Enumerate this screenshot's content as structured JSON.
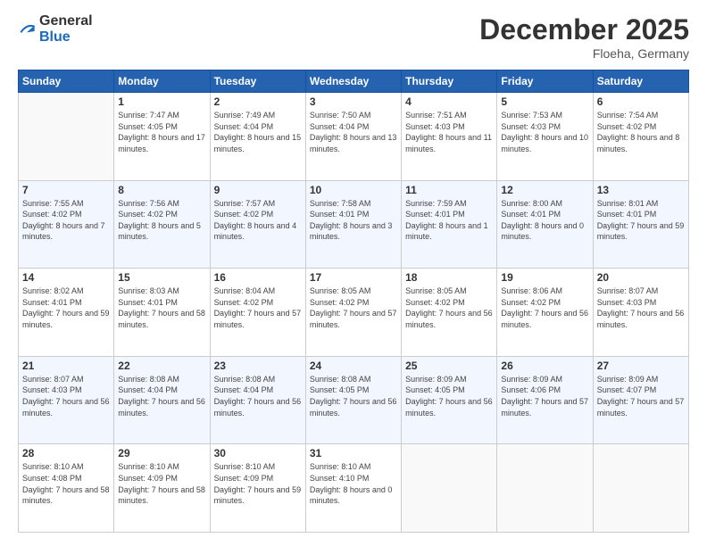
{
  "logo": {
    "general": "General",
    "blue": "Blue"
  },
  "header": {
    "month": "December 2025",
    "location": "Floeha, Germany"
  },
  "weekdays": [
    "Sunday",
    "Monday",
    "Tuesday",
    "Wednesday",
    "Thursday",
    "Friday",
    "Saturday"
  ],
  "weeks": [
    [
      {
        "day": "",
        "sunrise": "",
        "sunset": "",
        "daylight": ""
      },
      {
        "day": "1",
        "sunrise": "Sunrise: 7:47 AM",
        "sunset": "Sunset: 4:05 PM",
        "daylight": "Daylight: 8 hours and 17 minutes."
      },
      {
        "day": "2",
        "sunrise": "Sunrise: 7:49 AM",
        "sunset": "Sunset: 4:04 PM",
        "daylight": "Daylight: 8 hours and 15 minutes."
      },
      {
        "day": "3",
        "sunrise": "Sunrise: 7:50 AM",
        "sunset": "Sunset: 4:04 PM",
        "daylight": "Daylight: 8 hours and 13 minutes."
      },
      {
        "day": "4",
        "sunrise": "Sunrise: 7:51 AM",
        "sunset": "Sunset: 4:03 PM",
        "daylight": "Daylight: 8 hours and 11 minutes."
      },
      {
        "day": "5",
        "sunrise": "Sunrise: 7:53 AM",
        "sunset": "Sunset: 4:03 PM",
        "daylight": "Daylight: 8 hours and 10 minutes."
      },
      {
        "day": "6",
        "sunrise": "Sunrise: 7:54 AM",
        "sunset": "Sunset: 4:02 PM",
        "daylight": "Daylight: 8 hours and 8 minutes."
      }
    ],
    [
      {
        "day": "7",
        "sunrise": "Sunrise: 7:55 AM",
        "sunset": "Sunset: 4:02 PM",
        "daylight": "Daylight: 8 hours and 7 minutes."
      },
      {
        "day": "8",
        "sunrise": "Sunrise: 7:56 AM",
        "sunset": "Sunset: 4:02 PM",
        "daylight": "Daylight: 8 hours and 5 minutes."
      },
      {
        "day": "9",
        "sunrise": "Sunrise: 7:57 AM",
        "sunset": "Sunset: 4:02 PM",
        "daylight": "Daylight: 8 hours and 4 minutes."
      },
      {
        "day": "10",
        "sunrise": "Sunrise: 7:58 AM",
        "sunset": "Sunset: 4:01 PM",
        "daylight": "Daylight: 8 hours and 3 minutes."
      },
      {
        "day": "11",
        "sunrise": "Sunrise: 7:59 AM",
        "sunset": "Sunset: 4:01 PM",
        "daylight": "Daylight: 8 hours and 1 minute."
      },
      {
        "day": "12",
        "sunrise": "Sunrise: 8:00 AM",
        "sunset": "Sunset: 4:01 PM",
        "daylight": "Daylight: 8 hours and 0 minutes."
      },
      {
        "day": "13",
        "sunrise": "Sunrise: 8:01 AM",
        "sunset": "Sunset: 4:01 PM",
        "daylight": "Daylight: 7 hours and 59 minutes."
      }
    ],
    [
      {
        "day": "14",
        "sunrise": "Sunrise: 8:02 AM",
        "sunset": "Sunset: 4:01 PM",
        "daylight": "Daylight: 7 hours and 59 minutes."
      },
      {
        "day": "15",
        "sunrise": "Sunrise: 8:03 AM",
        "sunset": "Sunset: 4:01 PM",
        "daylight": "Daylight: 7 hours and 58 minutes."
      },
      {
        "day": "16",
        "sunrise": "Sunrise: 8:04 AM",
        "sunset": "Sunset: 4:02 PM",
        "daylight": "Daylight: 7 hours and 57 minutes."
      },
      {
        "day": "17",
        "sunrise": "Sunrise: 8:05 AM",
        "sunset": "Sunset: 4:02 PM",
        "daylight": "Daylight: 7 hours and 57 minutes."
      },
      {
        "day": "18",
        "sunrise": "Sunrise: 8:05 AM",
        "sunset": "Sunset: 4:02 PM",
        "daylight": "Daylight: 7 hours and 56 minutes."
      },
      {
        "day": "19",
        "sunrise": "Sunrise: 8:06 AM",
        "sunset": "Sunset: 4:02 PM",
        "daylight": "Daylight: 7 hours and 56 minutes."
      },
      {
        "day": "20",
        "sunrise": "Sunrise: 8:07 AM",
        "sunset": "Sunset: 4:03 PM",
        "daylight": "Daylight: 7 hours and 56 minutes."
      }
    ],
    [
      {
        "day": "21",
        "sunrise": "Sunrise: 8:07 AM",
        "sunset": "Sunset: 4:03 PM",
        "daylight": "Daylight: 7 hours and 56 minutes."
      },
      {
        "day": "22",
        "sunrise": "Sunrise: 8:08 AM",
        "sunset": "Sunset: 4:04 PM",
        "daylight": "Daylight: 7 hours and 56 minutes."
      },
      {
        "day": "23",
        "sunrise": "Sunrise: 8:08 AM",
        "sunset": "Sunset: 4:04 PM",
        "daylight": "Daylight: 7 hours and 56 minutes."
      },
      {
        "day": "24",
        "sunrise": "Sunrise: 8:08 AM",
        "sunset": "Sunset: 4:05 PM",
        "daylight": "Daylight: 7 hours and 56 minutes."
      },
      {
        "day": "25",
        "sunrise": "Sunrise: 8:09 AM",
        "sunset": "Sunset: 4:05 PM",
        "daylight": "Daylight: 7 hours and 56 minutes."
      },
      {
        "day": "26",
        "sunrise": "Sunrise: 8:09 AM",
        "sunset": "Sunset: 4:06 PM",
        "daylight": "Daylight: 7 hours and 57 minutes."
      },
      {
        "day": "27",
        "sunrise": "Sunrise: 8:09 AM",
        "sunset": "Sunset: 4:07 PM",
        "daylight": "Daylight: 7 hours and 57 minutes."
      }
    ],
    [
      {
        "day": "28",
        "sunrise": "Sunrise: 8:10 AM",
        "sunset": "Sunset: 4:08 PM",
        "daylight": "Daylight: 7 hours and 58 minutes."
      },
      {
        "day": "29",
        "sunrise": "Sunrise: 8:10 AM",
        "sunset": "Sunset: 4:09 PM",
        "daylight": "Daylight: 7 hours and 58 minutes."
      },
      {
        "day": "30",
        "sunrise": "Sunrise: 8:10 AM",
        "sunset": "Sunset: 4:09 PM",
        "daylight": "Daylight: 7 hours and 59 minutes."
      },
      {
        "day": "31",
        "sunrise": "Sunrise: 8:10 AM",
        "sunset": "Sunset: 4:10 PM",
        "daylight": "Daylight: 8 hours and 0 minutes."
      },
      {
        "day": "",
        "sunrise": "",
        "sunset": "",
        "daylight": ""
      },
      {
        "day": "",
        "sunrise": "",
        "sunset": "",
        "daylight": ""
      },
      {
        "day": "",
        "sunrise": "",
        "sunset": "",
        "daylight": ""
      }
    ]
  ]
}
